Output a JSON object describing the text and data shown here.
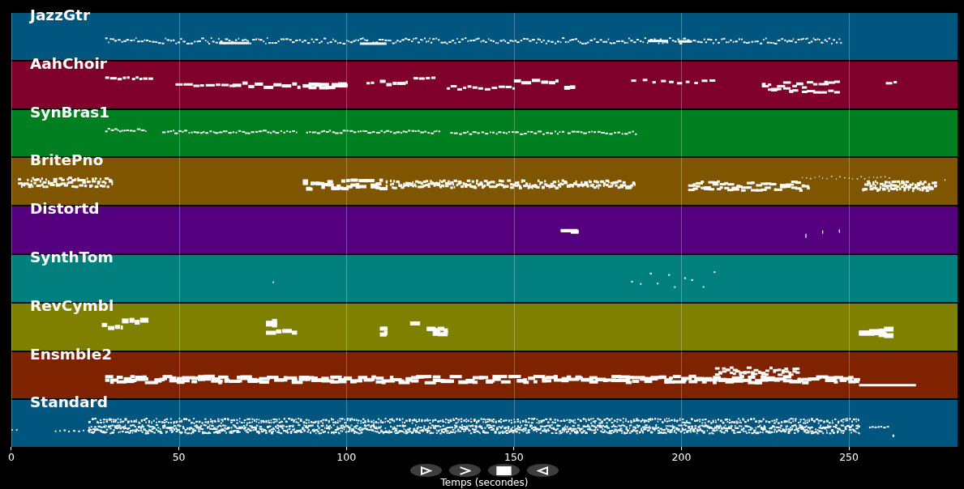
{
  "tracks": [
    {
      "name": "JazzGtr",
      "color": "#01567f"
    },
    {
      "name": "AahChoir",
      "color": "#7f002a"
    },
    {
      "name": "SynBras1",
      "color": "#007f20"
    },
    {
      "name": "BritePno",
      "color": "#7f5500"
    },
    {
      "name": "Distortd",
      "color": "#55007f"
    },
    {
      "name": "SynthTom",
      "color": "#007f7f"
    },
    {
      "name": "RevCymbl",
      "color": "#7f7f00"
    },
    {
      "name": "Ensmble2",
      "color": "#7f2200"
    },
    {
      "name": "Standard",
      "color": "#01567f"
    }
  ],
  "axis": {
    "ticks": [
      "0",
      "50",
      "100",
      "150",
      "200",
      "250"
    ],
    "label": "Temps (secondes)"
  },
  "controls": [
    {
      "kind": "play"
    },
    {
      "kind": "forward"
    },
    {
      "kind": "stop"
    },
    {
      "kind": "back"
    }
  ]
}
